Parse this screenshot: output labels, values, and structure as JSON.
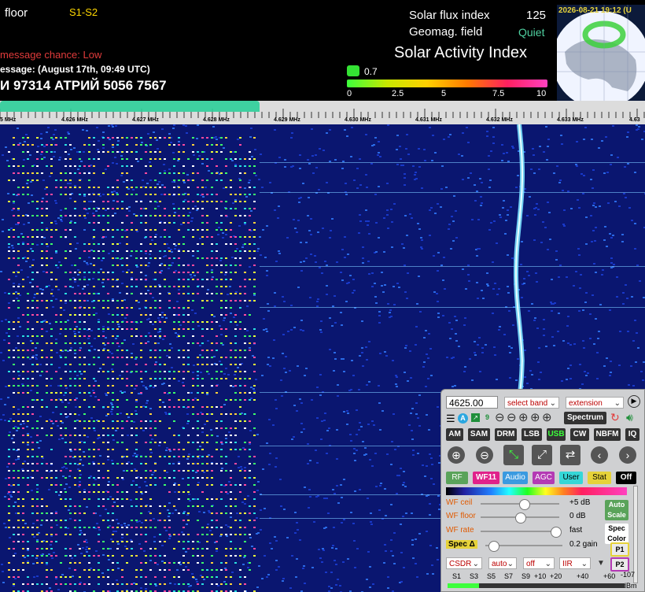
{
  "header": {
    "squelch_label": "floor",
    "band_conditions": "S1-S2",
    "message_chance": "message chance: Low",
    "message_time": "essage: (August 17th, 09:49 UTC)",
    "message_text": "И 97314 АТРИЙ 5056 7567",
    "solar_flux_label": "Solar flux index",
    "solar_flux_value": "125",
    "geomag_label": "Geomag. field",
    "geomag_value": "Quiet",
    "activity_title": "Solar Activity Index",
    "activity_value": "0.7",
    "activity_level": 0.07,
    "scale_ticks": [
      "0",
      "2.5",
      "5",
      "7.5",
      "10"
    ],
    "map_timestamp": "2026-08-21 19:12 (U"
  },
  "frequency_scale": {
    "labels": [
      "5 MHz",
      "4.626 MHz",
      "4.627 MHz",
      "4.628 MHz",
      "4.629 MHz",
      "4.630 MHz",
      "4.631 MHz",
      "4.632 MHz",
      "4.633 MHz",
      "4.63"
    ]
  },
  "control_panel": {
    "frequency_input": "4625.00",
    "band_select": "select band",
    "extension_select": "extension",
    "spectrum_button": "Spectrum",
    "menu_icons": [
      "menu-icon",
      "a-badge-icon",
      "link-icon",
      "9-badge-icon"
    ],
    "zoom_icons": [
      "zoom-out-small-icon",
      "zoom-out-icon",
      "zoom-in-icon",
      "zoom-in-small-icon",
      "zoom-in-max-icon"
    ],
    "modes": [
      "AM",
      "SAM",
      "DRM",
      "LSB",
      "USB",
      "CW",
      "NBFM",
      "IQ"
    ],
    "active_mode": "USB",
    "tabs": [
      {
        "label": "RF",
        "color": "#5aa35a"
      },
      {
        "label": "WF11",
        "color": "#e0218a"
      },
      {
        "label": "Audio",
        "color": "#3a9ae0"
      },
      {
        "label": "AGC",
        "color": "#b43ab4"
      },
      {
        "label": "User",
        "color": "#35d7d7"
      },
      {
        "label": "Stat",
        "color": "#e6d23a"
      },
      {
        "label": "Off",
        "color": "#000000"
      }
    ],
    "sliders": [
      {
        "label": "WF ceil",
        "value": "+5 dB",
        "level": 0.55
      },
      {
        "label": "WF floor",
        "value": "0 dB",
        "level": 0.5
      },
      {
        "label": "WF rate",
        "value": "fast",
        "level": 0.95
      },
      {
        "label": "Spec Δ",
        "value": "0.2 gain",
        "level": 0.1
      }
    ],
    "auto_scale_label": "Auto Scale",
    "spec_color_label": "Spec Color",
    "p1_label": "P1",
    "p2_label": "P2",
    "bottom_selects": [
      "CSDR",
      "auto",
      "off",
      "IIR"
    ],
    "smeter_ticks": [
      "S1",
      "S3",
      "S5",
      "S7",
      "S9",
      "+10",
      "+20",
      "+40",
      "+60",
      "-107",
      "dBm"
    ]
  }
}
